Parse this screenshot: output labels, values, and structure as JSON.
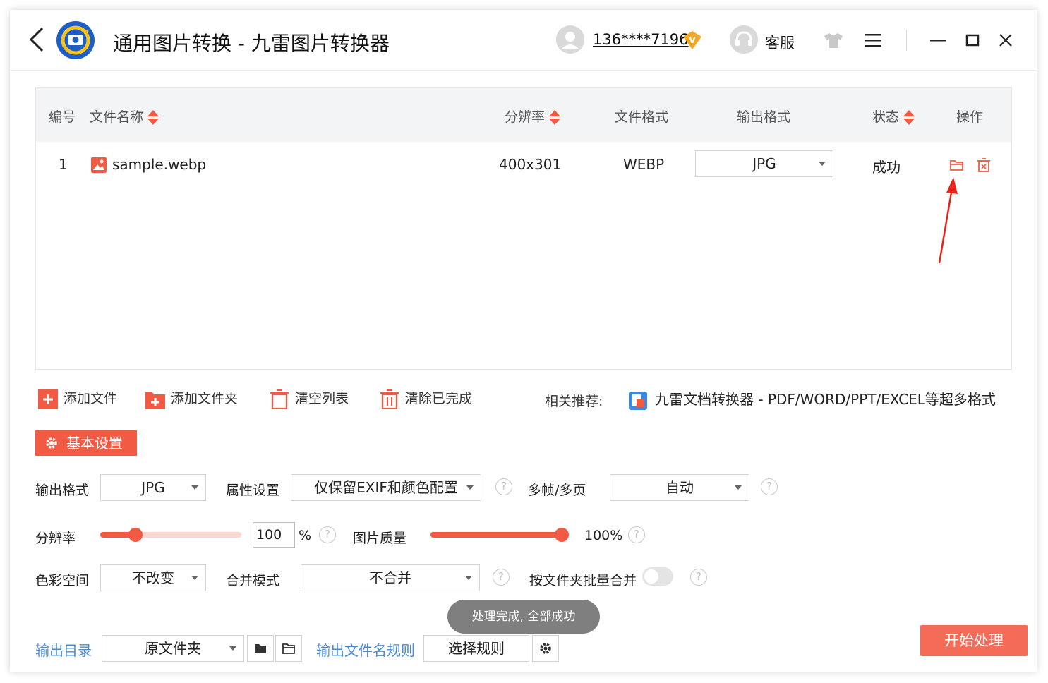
{
  "titlebar": {
    "title": "通用图片转换 - 九雷图片转换器",
    "user": "136****7196",
    "vip_badge": "V",
    "service_label": "客服",
    "icons": [
      "back-chevron-icon",
      "app-logo-icon",
      "avatar-icon",
      "vip-badge-icon",
      "headset-icon",
      "tshirt-icon",
      "menu-icon",
      "minimize-icon",
      "maximize-icon",
      "close-icon"
    ]
  },
  "table": {
    "headers": {
      "index": "编号",
      "name": "文件名称",
      "resolution": "分辨率",
      "format": "文件格式",
      "output": "输出格式",
      "status": "状态",
      "actions": "操作"
    },
    "rows": [
      {
        "index": "1",
        "name": "sample.webp",
        "resolution": "400x301",
        "format": "WEBP",
        "output": "JPG",
        "status": "成功"
      }
    ]
  },
  "toolbar": {
    "add_file": "添加文件",
    "add_folder": "添加文件夹",
    "clear_list": "清空列表",
    "clear_done": "清除已完成",
    "recommend_label": "相关推荐:",
    "recommend_link": "九雷文档转换器 - PDF/WORD/PPT/EXCEL等超多格式"
  },
  "settings": {
    "basic_label": "基本设置",
    "output_format_label": "输出格式",
    "output_format_value": "JPG",
    "attribute_label": "属性设置",
    "attribute_value": "仅保留EXIF和颜色配置",
    "multiframe_label": "多帧/多页",
    "multiframe_value": "自动",
    "resolution_label": "分辨率",
    "resolution_value": "100",
    "resolution_unit": "%",
    "resolution_slider_fraction": 0.22,
    "quality_label": "图片质量",
    "quality_value": "100%",
    "quality_fraction": 1.0,
    "colorspace_label": "色彩空间",
    "colorspace_value": "不改变",
    "merge_label": "合并模式",
    "merge_value": "不合并",
    "folder_merge_label": "按文件夹批量合并",
    "folder_merge_on": false,
    "help_glyph": "?"
  },
  "status_toast": "处理完成, 全部成功",
  "footer": {
    "output_dir_label": "输出目录",
    "output_dir_value": "原文件夹",
    "filename_rule_label": "输出文件名规则",
    "filename_rule_value": "选择规则",
    "start_button": "开始处理"
  },
  "colors": {
    "accent": "#f25a43",
    "link": "#4a8ad6",
    "toast": "#7f7f7f"
  }
}
